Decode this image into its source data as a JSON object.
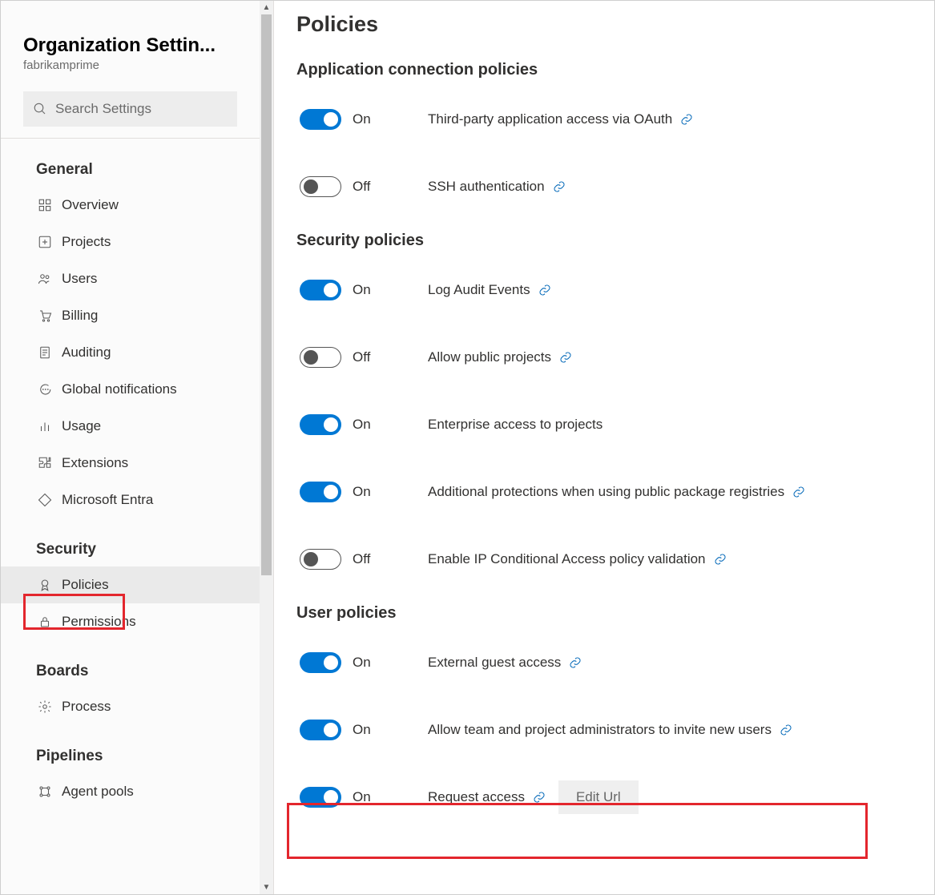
{
  "sidebar": {
    "title": "Organization Settin...",
    "subtitle": "fabrikamprime",
    "search_placeholder": "Search Settings",
    "sections": [
      {
        "title": "General",
        "items": [
          {
            "label": "Overview",
            "icon": "grid-icon"
          },
          {
            "label": "Projects",
            "icon": "plus-box-icon"
          },
          {
            "label": "Users",
            "icon": "people-icon"
          },
          {
            "label": "Billing",
            "icon": "cart-icon"
          },
          {
            "label": "Auditing",
            "icon": "log-icon"
          },
          {
            "label": "Global notifications",
            "icon": "chat-icon"
          },
          {
            "label": "Usage",
            "icon": "bar-chart-icon"
          },
          {
            "label": "Extensions",
            "icon": "puzzle-icon"
          },
          {
            "label": "Microsoft Entra",
            "icon": "diamond-icon"
          }
        ]
      },
      {
        "title": "Security",
        "items": [
          {
            "label": "Policies",
            "icon": "ribbon-icon",
            "selected": true
          },
          {
            "label": "Permissions",
            "icon": "lock-icon"
          }
        ]
      },
      {
        "title": "Boards",
        "items": [
          {
            "label": "Process",
            "icon": "gear-icon"
          }
        ]
      },
      {
        "title": "Pipelines",
        "items": [
          {
            "label": "Agent pools",
            "icon": "pool-icon"
          }
        ]
      }
    ]
  },
  "main": {
    "title": "Policies",
    "on_label": "On",
    "off_label": "Off",
    "edit_url_label": "Edit Url",
    "groups": [
      {
        "title": "Application connection policies",
        "items": [
          {
            "label": "Third-party application access via OAuth",
            "state": "on",
            "link": true
          },
          {
            "label": "SSH authentication",
            "state": "off",
            "link": true
          }
        ]
      },
      {
        "title": "Security policies",
        "items": [
          {
            "label": "Log Audit Events",
            "state": "on",
            "link": true
          },
          {
            "label": "Allow public projects",
            "state": "off",
            "link": true
          },
          {
            "label": "Enterprise access to projects",
            "state": "on",
            "link": false
          },
          {
            "label": "Additional protections when using public package registries",
            "state": "on",
            "link": true
          },
          {
            "label": "Enable IP Conditional Access policy validation",
            "state": "off",
            "link": true
          }
        ]
      },
      {
        "title": "User policies",
        "items": [
          {
            "label": "External guest access",
            "state": "on",
            "link": true
          },
          {
            "label": "Allow team and project administrators to invite new users",
            "state": "on",
            "link": true
          },
          {
            "label": "Request access",
            "state": "on",
            "link": true,
            "edit_url": true
          }
        ]
      }
    ]
  }
}
